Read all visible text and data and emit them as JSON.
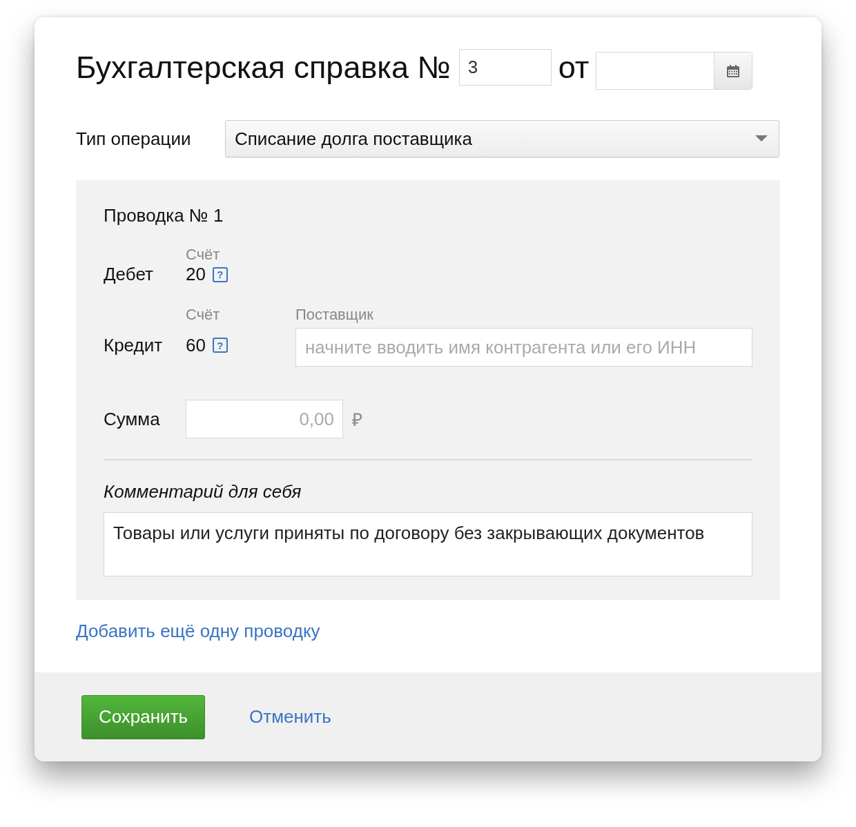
{
  "dialog": {
    "title": "Бухгалтерская справка №",
    "number": "3",
    "date_label": "от"
  },
  "operation_type": {
    "label": "Тип операции",
    "value": "Списание долга поставщика"
  },
  "entry": {
    "title": "Проводка № 1",
    "debit": {
      "label": "Дебет",
      "account_label": "Счёт",
      "account": "20",
      "help": "?"
    },
    "credit": {
      "label": "Кредит",
      "account_label": "Счёт",
      "account": "60",
      "help": "?",
      "supplier_label": "Поставщик",
      "supplier_placeholder": "начните вводить имя контрагента или его ИНН"
    },
    "amount": {
      "label": "Сумма",
      "placeholder": "0,00",
      "currency": "₽"
    },
    "comment": {
      "label": "Комментарий для себя",
      "value": "Товары или услуги приняты по договору без закрывающих документов"
    }
  },
  "add_entry_link": "Добавить ещё одну проводку",
  "buttons": {
    "save": "Сохранить",
    "cancel": "Отменить"
  }
}
